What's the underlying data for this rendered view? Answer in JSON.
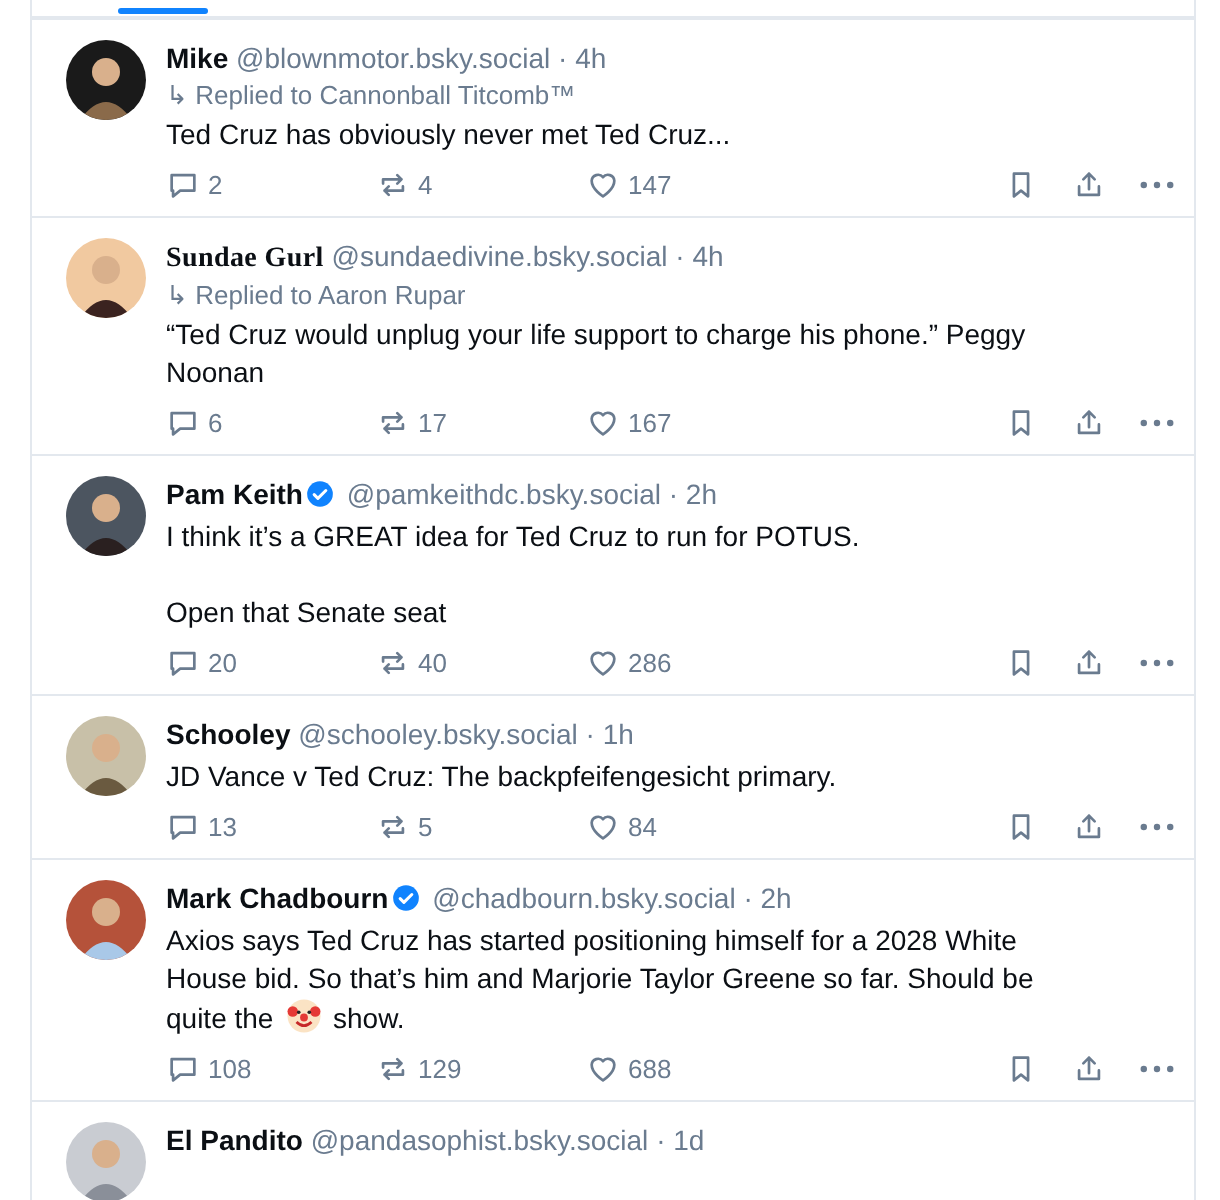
{
  "tabs_indicator": {
    "selected": true
  },
  "posts": [
    {
      "name": "Mike",
      "decorative_name": false,
      "verified": false,
      "handle": "@blownmotor.bsky.social",
      "time": "· 4h",
      "reply_to": "↳ Replied to Cannonball Titcomb™",
      "text_parts": [
        "Ted Cruz has obviously never met Ted Cruz..."
      ],
      "replies": "2",
      "reposts": "4",
      "likes": "147"
    },
    {
      "name": "Sundae Gurl",
      "decorative_name": true,
      "verified": false,
      "handle": "@sundaedivine.bsky.social",
      "time": "· 4h",
      "reply_to": "↳ Replied to Aaron Rupar",
      "text_parts": [
        "“Ted Cruz would unplug your life support to charge his phone.”  Peggy Noonan"
      ],
      "replies": "6",
      "reposts": "17",
      "likes": "167"
    },
    {
      "name": "Pam Keith",
      "decorative_name": false,
      "verified": true,
      "handle": "@pamkeithdc.bsky.social",
      "time": "· 2h",
      "text_parts": [
        "I think it’s a GREAT idea for Ted Cruz to run for POTUS.\n\nOpen that Senate seat"
      ],
      "replies": "20",
      "reposts": "40",
      "likes": "286"
    },
    {
      "name": "Schooley",
      "decorative_name": false,
      "verified": false,
      "handle": "@schooley.bsky.social",
      "time": "· 1h",
      "text_parts": [
        "JD Vance v Ted Cruz: The backpfeifengesicht primary."
      ],
      "replies": "13",
      "reposts": "5",
      "likes": "84"
    },
    {
      "name": "Mark Chadbourn",
      "decorative_name": false,
      "verified": true,
      "handle": "@chadbourn.bsky.social",
      "time": "· 2h",
      "text_parts": [
        "Axios says Ted Cruz has started positioning himself for a 2028 White House bid. So that’s him and Marjorie Taylor Greene so far. Should be quite the",
        "show."
      ],
      "replies": "108",
      "reposts": "129",
      "likes": "688"
    },
    {
      "name": "El Pandito",
      "decorative_name": false,
      "verified": false,
      "handle": "@pandasophist.bsky.social",
      "time": "· 1d"
    }
  ]
}
